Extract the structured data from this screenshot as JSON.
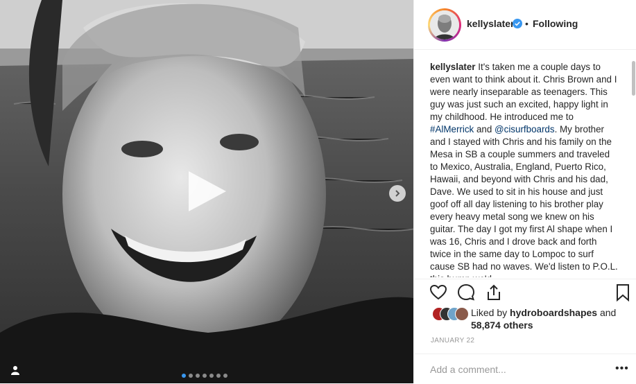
{
  "post": {
    "username": "kellyslater",
    "follow_state": "Following",
    "separator": "•",
    "caption": {
      "username": "kellyslater",
      "parts": [
        {
          "t": "text",
          "v": " It's taken me a couple days to even want to think about it. Chris Brown and I were nearly inseparable as teenagers. This guy was just such an excited, happy light in my childhood. He introduced me to "
        },
        {
          "t": "link",
          "v": "#AlMerrick"
        },
        {
          "t": "text",
          "v": " and "
        },
        {
          "t": "link",
          "v": "@cisurfboards"
        },
        {
          "t": "text",
          "v": ". My brother and I stayed with Chris and his family on the Mesa in SB a couple summers and traveled to Mexico, Australia, England, Puerto Rico, Hawaii, and beyond with Chris and his dad, Dave. We used to sit in his house and just goof off all day listening to his brother play every heavy metal song we knew on his guitar. The day I got my first Al shape when I was 16, Chris and I drove back and forth twice in the same day to Lompoc to surf cause SB had no waves. We'd listen to P.O.L. this bump we'd"
        }
      ]
    },
    "likes": {
      "prefix": "Liked by ",
      "user": "hydroboardshapes",
      "middle": " and",
      "others": "58,874 others"
    },
    "date": "JANUARY 22",
    "comment_placeholder": "Add a comment...",
    "more_label": "•••"
  },
  "media": {
    "carousel_count": 7,
    "active_index": 0
  },
  "colors": {
    "verified": "#3897f0",
    "link": "#003569",
    "active_dot": "#3897f0"
  },
  "icons": [
    "play-icon",
    "chevron-right-icon",
    "user-tag-icon",
    "heart-icon",
    "comment-icon",
    "share-icon",
    "bookmark-icon",
    "verified-icon"
  ]
}
